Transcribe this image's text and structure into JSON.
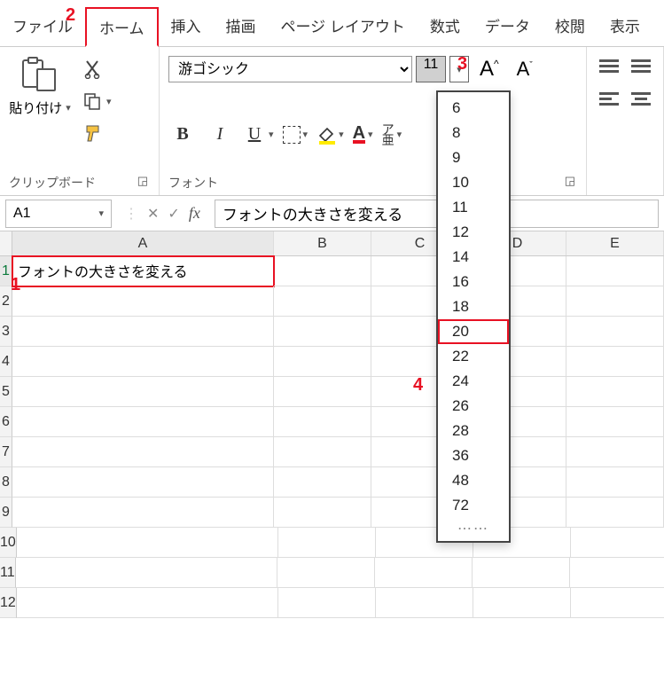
{
  "annotations": {
    "a1": "1",
    "a2": "2",
    "a3": "3",
    "a4": "4"
  },
  "menubar": {
    "tabs": [
      "ファイル",
      "ホーム",
      "挿入",
      "描画",
      "ページ レイアウト",
      "数式",
      "データ",
      "校閲",
      "表示"
    ],
    "active": "ホーム"
  },
  "ribbon": {
    "clipboard": {
      "paste": "貼り付け",
      "group": "クリップボード"
    },
    "font": {
      "name": "游ゴシック",
      "size": "11",
      "group": "フォント",
      "bold": "B",
      "italic": "I",
      "underline": "U",
      "ruby_top": "ア",
      "ruby_bot": "亜",
      "bigA": "A",
      "smallA": "A",
      "colorA": "A"
    },
    "size_options": [
      "6",
      "8",
      "9",
      "10",
      "11",
      "12",
      "14",
      "16",
      "18",
      "20",
      "22",
      "24",
      "26",
      "28",
      "36",
      "48",
      "72"
    ],
    "size_highlight": "20"
  },
  "formula_bar": {
    "name_box": "A1",
    "fx": "fx",
    "value": "フォントの大きさを変える"
  },
  "grid": {
    "columns": [
      "A",
      "B",
      "C",
      "D",
      "E"
    ],
    "rows": [
      "1",
      "2",
      "3",
      "4",
      "5",
      "6",
      "7",
      "8",
      "9",
      "10",
      "11",
      "12"
    ],
    "a1_value": "フォントの大きさを変える"
  }
}
